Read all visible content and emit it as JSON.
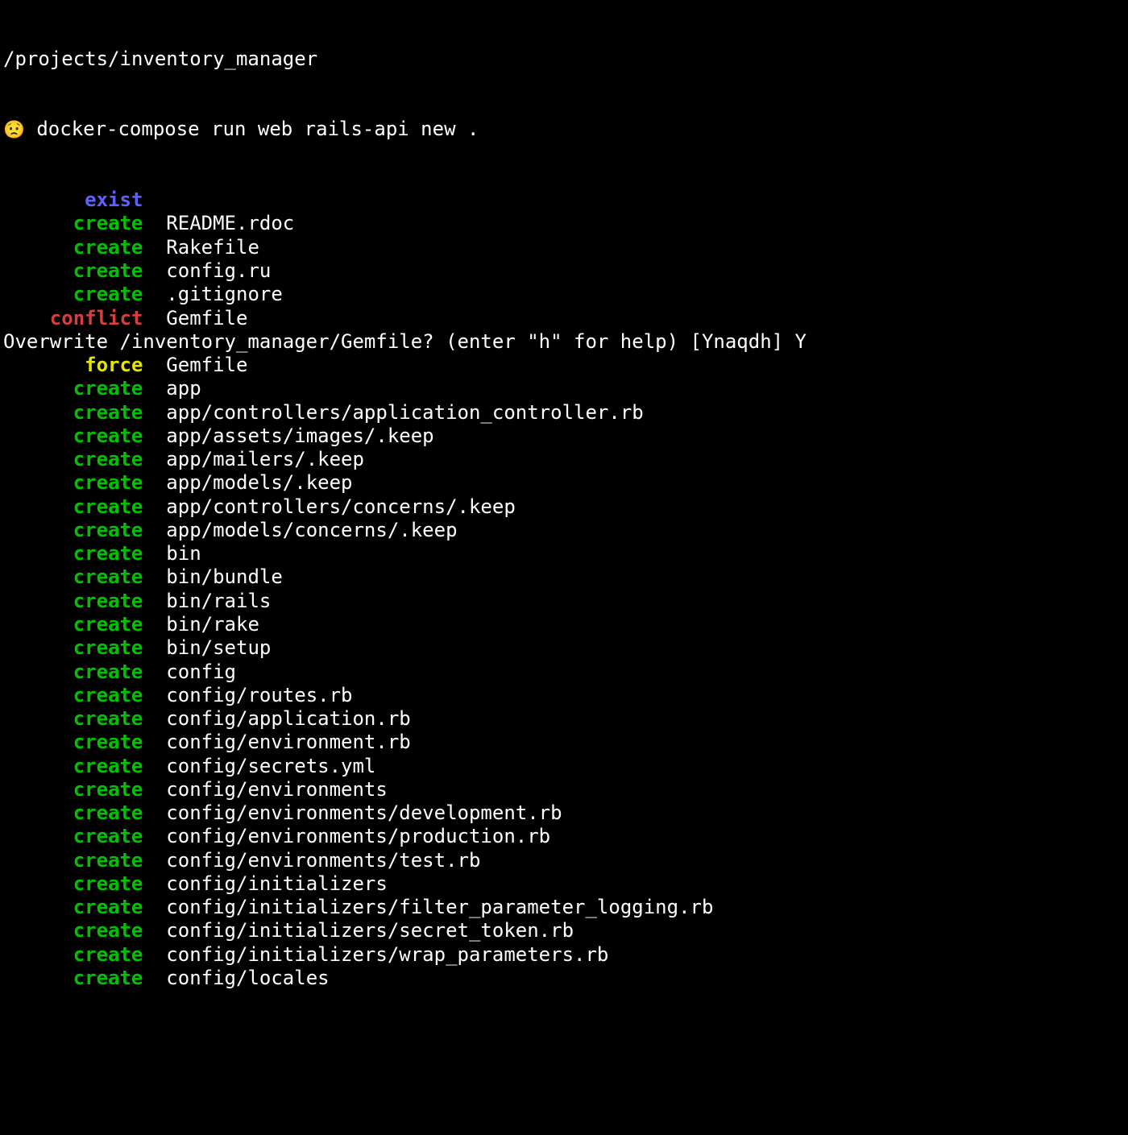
{
  "colors": {
    "create": "c-green",
    "exist": "c-blue",
    "conflict": "c-red",
    "force": "c-yellow"
  },
  "top_path": "/projects/inventory_manager",
  "prompt_emoji": "😟",
  "prompt_cmd": " docker-compose run web rails-api new .",
  "overwrite_prompt": "Overwrite /inventory_manager/Gemfile? (enter \"h\" for help) [Ynaqdh] Y",
  "lines": [
    {
      "status": "exist",
      "path": ""
    },
    {
      "status": "create",
      "path": "README.rdoc"
    },
    {
      "status": "create",
      "path": "Rakefile"
    },
    {
      "status": "create",
      "path": "config.ru"
    },
    {
      "status": "create",
      "path": ".gitignore"
    },
    {
      "status": "conflict",
      "path": "Gemfile"
    },
    {
      "type": "overwrite"
    },
    {
      "status": "force",
      "path": "Gemfile"
    },
    {
      "status": "create",
      "path": "app"
    },
    {
      "status": "create",
      "path": "app/controllers/application_controller.rb"
    },
    {
      "status": "create",
      "path": "app/assets/images/.keep"
    },
    {
      "status": "create",
      "path": "app/mailers/.keep"
    },
    {
      "status": "create",
      "path": "app/models/.keep"
    },
    {
      "status": "create",
      "path": "app/controllers/concerns/.keep"
    },
    {
      "status": "create",
      "path": "app/models/concerns/.keep"
    },
    {
      "status": "create",
      "path": "bin"
    },
    {
      "status": "create",
      "path": "bin/bundle"
    },
    {
      "status": "create",
      "path": "bin/rails"
    },
    {
      "status": "create",
      "path": "bin/rake"
    },
    {
      "status": "create",
      "path": "bin/setup"
    },
    {
      "status": "create",
      "path": "config"
    },
    {
      "status": "create",
      "path": "config/routes.rb"
    },
    {
      "status": "create",
      "path": "config/application.rb"
    },
    {
      "status": "create",
      "path": "config/environment.rb"
    },
    {
      "status": "create",
      "path": "config/secrets.yml"
    },
    {
      "status": "create",
      "path": "config/environments"
    },
    {
      "status": "create",
      "path": "config/environments/development.rb"
    },
    {
      "status": "create",
      "path": "config/environments/production.rb"
    },
    {
      "status": "create",
      "path": "config/environments/test.rb"
    },
    {
      "status": "create",
      "path": "config/initializers"
    },
    {
      "status": "create",
      "path": "config/initializers/filter_parameter_logging.rb"
    },
    {
      "status": "create",
      "path": "config/initializers/secret_token.rb"
    },
    {
      "status": "create",
      "path": "config/initializers/wrap_parameters.rb"
    },
    {
      "status": "create",
      "path": "config/locales"
    }
  ]
}
